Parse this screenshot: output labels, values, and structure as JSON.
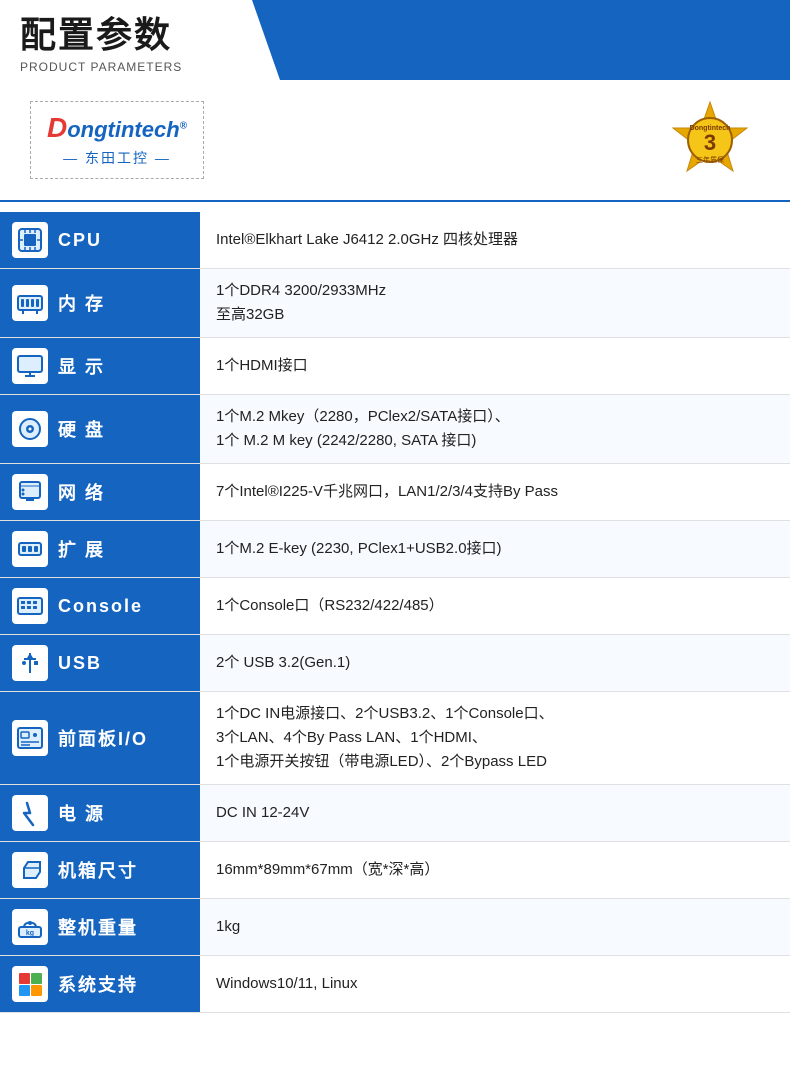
{
  "header": {
    "title_cn": "配置参数",
    "title_en": "PRODUCT PARAMETERS"
  },
  "brand": {
    "logo_prefix": "ongtintech",
    "logo_d": "D",
    "logo_registered": "®",
    "logo_bottom": "— 东田工控 —"
  },
  "warranty": {
    "number": "3",
    "text": "三年质保"
  },
  "specs": [
    {
      "id": "cpu",
      "label": "CPU",
      "icon": "💻",
      "value": "Intel®Elkhart Lake J6412 2.0GHz 四核处理器"
    },
    {
      "id": "memory",
      "label": "内  存",
      "icon": "🧩",
      "value": "1个DDR4 3200/2933MHz\n至高32GB"
    },
    {
      "id": "display",
      "label": "显  示",
      "icon": "🖥",
      "value": "1个HDMI接口"
    },
    {
      "id": "storage",
      "label": "硬  盘",
      "icon": "💾",
      "value": "1个M.2 Mkey（2280，PClex2/SATA接口）、\n1个 M.2 M key (2242/2280, SATA 接口)"
    },
    {
      "id": "network",
      "label": "网  络",
      "icon": "🌐",
      "value": "7个Intel®I225-V千兆网口，LAN1/2/3/4支持By Pass"
    },
    {
      "id": "expansion",
      "label": "扩  展",
      "icon": "📡",
      "value": "1个M.2 E-key (2230, PClex1+USB2.0接口)"
    },
    {
      "id": "console",
      "label": "Console",
      "icon": "⌨",
      "value": "1个Console口（RS232/422/485）"
    },
    {
      "id": "usb",
      "label": "USB",
      "icon": "🔌",
      "value": "2个 USB 3.2(Gen.1)"
    },
    {
      "id": "front-io",
      "label": "前面板I/O",
      "icon": "🖱",
      "value": "1个DC IN电源接口、2个USB3.2、1个Console口、\n3个LAN、4个By Pass LAN、1个HDMI、\n1个电源开关按钮（带电源LED）、2个Bypass LED"
    },
    {
      "id": "power",
      "label": "电  源",
      "icon": "⚡",
      "value": "DC IN 12-24V"
    },
    {
      "id": "dimensions",
      "label": "机箱尺寸",
      "icon": "📐",
      "value": "16mm*89mm*67mm（宽*深*高）"
    },
    {
      "id": "weight",
      "label": "整机重量",
      "icon": "⚖",
      "value": "1kg"
    },
    {
      "id": "os",
      "label": "系统支持",
      "icon": "🪟",
      "value": "Windows10/11, Linux"
    }
  ]
}
